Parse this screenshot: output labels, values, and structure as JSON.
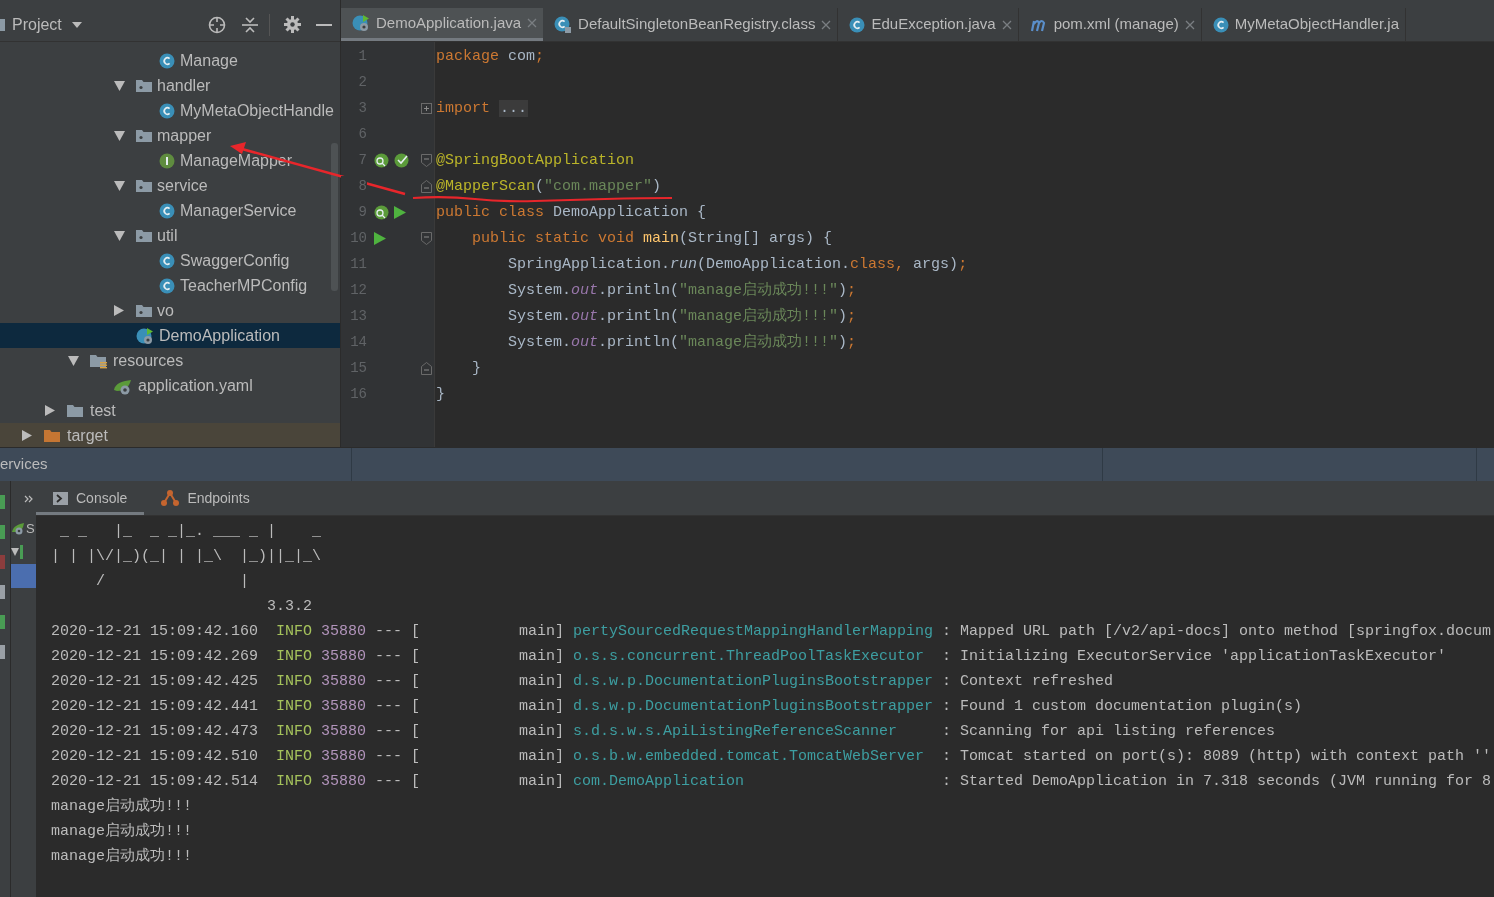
{
  "project_panel": {
    "title": "Project",
    "tree": [
      {
        "children": [
          {
            "children": [
              {
                "children": [
                  {
                    "children": [
                      {
                        "children": [
                          {
                            "label": "Manage",
                            "kind": "class",
                            "selected": false
                          }
                        ]
                      },
                      {
                        "label": "handler",
                        "kind": "package",
                        "expanded": true,
                        "selected": false,
                        "children": [
                          {
                            "label": "MyMetaObjectHandle",
                            "kind": "class",
                            "selected": false
                          }
                        ]
                      },
                      {
                        "label": "mapper",
                        "kind": "package",
                        "expanded": true,
                        "selected": false,
                        "children": [
                          {
                            "label": "ManageMapper",
                            "kind": "interface",
                            "selected": false
                          }
                        ]
                      },
                      {
                        "label": "service",
                        "kind": "package",
                        "expanded": true,
                        "selected": false,
                        "children": [
                          {
                            "label": "ManagerService",
                            "kind": "class",
                            "selected": false
                          }
                        ]
                      },
                      {
                        "label": "util",
                        "kind": "package",
                        "expanded": true,
                        "selected": false,
                        "children": [
                          {
                            "label": "SwaggerConfig",
                            "kind": "class",
                            "selected": false
                          },
                          {
                            "label": "TeacherMPConfig",
                            "kind": "class",
                            "selected": false
                          }
                        ]
                      },
                      {
                        "label": "vo",
                        "kind": "package",
                        "expanded": false,
                        "selected": false
                      },
                      {
                        "label": "DemoApplication",
                        "kind": "spring-class",
                        "selected": true
                      }
                    ]
                  }
                ]
              },
              {
                "label": "resources",
                "kind": "resources",
                "expanded": true,
                "selected": false,
                "children": [
                  {
                    "label": "application.yaml",
                    "kind": "yaml",
                    "selected": false
                  }
                ]
              }
            ]
          },
          {
            "label": "test",
            "kind": "folder",
            "expanded": false,
            "selected": false
          }
        ]
      },
      {
        "label": "target",
        "kind": "excluded",
        "expanded": false,
        "selected": false
      }
    ]
  },
  "tabs": [
    {
      "label": "DemoApplication.java",
      "kind": "spring",
      "selected": true,
      "closable": true
    },
    {
      "label": "DefaultSingletonBeanRegistry.class",
      "kind": "class-locked",
      "selected": false,
      "closable": true
    },
    {
      "label": "EduException.java",
      "kind": "class",
      "selected": false,
      "closable": true
    },
    {
      "label": "pom.xml (manage)",
      "kind": "maven",
      "selected": false,
      "closable": true
    },
    {
      "label": "MyMetaObjectHandler.ja",
      "kind": "class",
      "selected": false,
      "closable": false
    }
  ],
  "code": [
    {
      "number": "1",
      "tokens": [
        {
          "text": "package",
          "kind": "kw"
        },
        {
          "text": " com",
          "kind": "plain"
        },
        {
          "text": ";",
          "kind": "kw"
        }
      ]
    },
    {
      "number": "2"
    },
    {
      "number": "3",
      "folded": true,
      "tokens": [
        {
          "text": "import ",
          "kind": "kw"
        },
        {
          "text": "...",
          "kind": "folded"
        }
      ]
    },
    {
      "number": "6"
    },
    {
      "number": "7",
      "fold_start": true,
      "markers": [
        {
          "kind": "bean"
        },
        {
          "kind": "bean-check"
        }
      ],
      "tokens": [
        {
          "text": "@SpringBootApplication",
          "kind": "ann"
        }
      ]
    },
    {
      "number": "8",
      "fold_end": true,
      "tokens": [
        {
          "text": "@MapperScan",
          "kind": "ann"
        },
        {
          "text": "(",
          "kind": "plain"
        },
        {
          "text": "\"com.mapper\"",
          "kind": "str"
        },
        {
          "text": ")",
          "kind": "plain"
        }
      ]
    },
    {
      "number": "9",
      "markers": [
        {
          "kind": "bean"
        },
        {
          "kind": "run"
        }
      ],
      "tokens": [
        {
          "text": "public class ",
          "kind": "kw"
        },
        {
          "text": "DemoApplication {",
          "kind": "plain"
        }
      ]
    },
    {
      "number": "10",
      "fold_start": true,
      "markers": [
        {
          "kind": "run"
        }
      ],
      "tokens": [
        {
          "text": "    public static void ",
          "kind": "kw"
        },
        {
          "text": "main",
          "kind": "fn"
        },
        {
          "text": "(String[] args) {",
          "kind": "plain"
        }
      ]
    },
    {
      "number": "11",
      "tokens": [
        {
          "text": "        SpringApplication.",
          "kind": "plain"
        },
        {
          "text": "run",
          "kind": "static"
        },
        {
          "text": "(DemoApplication.",
          "kind": "plain"
        },
        {
          "text": "class, ",
          "kind": "kw"
        },
        {
          "text": "args)",
          "kind": "plain"
        },
        {
          "text": ";",
          "kind": "kw"
        }
      ]
    },
    {
      "number": "12",
      "tokens": [
        {
          "text": "        System.",
          "kind": "plain"
        },
        {
          "text": "out",
          "kind": "field"
        },
        {
          "text": ".println(",
          "kind": "plain"
        },
        {
          "text": "\"manage启动成功!!!\"",
          "kind": "str"
        },
        {
          "text": ")",
          "kind": "plain"
        },
        {
          "text": ";",
          "kind": "kw"
        }
      ]
    },
    {
      "number": "13",
      "tokens": [
        {
          "text": "        System.",
          "kind": "plain"
        },
        {
          "text": "out",
          "kind": "field"
        },
        {
          "text": ".println(",
          "kind": "plain"
        },
        {
          "text": "\"manage启动成功!!!\"",
          "kind": "str"
        },
        {
          "text": ")",
          "kind": "plain"
        },
        {
          "text": ";",
          "kind": "kw"
        }
      ]
    },
    {
      "number": "14",
      "tokens": [
        {
          "text": "        System.",
          "kind": "plain"
        },
        {
          "text": "out",
          "kind": "field"
        },
        {
          "text": ".println(",
          "kind": "plain"
        },
        {
          "text": "\"manage启动成功!!!\"",
          "kind": "str"
        },
        {
          "text": ")",
          "kind": "plain"
        },
        {
          "text": ";",
          "kind": "kw"
        }
      ]
    },
    {
      "number": "15",
      "fold_end": true,
      "tokens": [
        {
          "text": "    }",
          "kind": "plain"
        }
      ]
    },
    {
      "number": "16",
      "tokens": [
        {
          "text": "}",
          "kind": "plain"
        }
      ]
    }
  ],
  "services_bar": {
    "title": "ervices"
  },
  "services": [
    {
      "label": "S",
      "kind": "spring",
      "selected": false
    },
    {
      "kind": "group",
      "expanded": true,
      "selected": false
    },
    {
      "kind": "item",
      "selected": true
    }
  ],
  "console_tabs": [
    {
      "label": "Console",
      "kind": "console",
      "selected": true
    },
    {
      "label": "Endpoints",
      "kind": "endpoints",
      "selected": false
    }
  ],
  "console": [
    {
      "kind": "banner",
      "text": " _ _   |_  _ _|_. ___ _ |    _"
    },
    {
      "kind": "banner",
      "text": "| | |\\/|_)(_| | |_\\  |_)||_|_\\"
    },
    {
      "kind": "banner",
      "text": "     /               |"
    },
    {
      "kind": "banner",
      "text": "                        3.3.2"
    },
    {
      "kind": "log",
      "timestamp": "2020-12-21 15:09:42.160",
      "level": "INFO",
      "pid": "35880",
      "separator": "---",
      "thread": "[           main]",
      "logger": "pertySourcedRequestMappingHandlerMapping",
      "message": ": Mapped URL path [/v2/api-docs] onto method [springfox.docum"
    },
    {
      "kind": "log",
      "timestamp": "2020-12-21 15:09:42.269",
      "level": "INFO",
      "pid": "35880",
      "separator": "---",
      "thread": "[           main]",
      "logger": "o.s.s.concurrent.ThreadPoolTaskExecutor",
      "message": ": Initializing ExecutorService 'applicationTaskExecutor'"
    },
    {
      "kind": "log",
      "timestamp": "2020-12-21 15:09:42.425",
      "level": "INFO",
      "pid": "35880",
      "separator": "---",
      "thread": "[           main]",
      "logger": "d.s.w.p.DocumentationPluginsBootstrapper",
      "message": ": Context refreshed"
    },
    {
      "kind": "log",
      "timestamp": "2020-12-21 15:09:42.441",
      "level": "INFO",
      "pid": "35880",
      "separator": "---",
      "thread": "[           main]",
      "logger": "d.s.w.p.DocumentationPluginsBootstrapper",
      "message": ": Found 1 custom documentation plugin(s)"
    },
    {
      "kind": "log",
      "timestamp": "2020-12-21 15:09:42.473",
      "level": "INFO",
      "pid": "35880",
      "separator": "---",
      "thread": "[           main]",
      "logger": "s.d.s.w.s.ApiListingReferenceScanner",
      "message": ": Scanning for api listing references"
    },
    {
      "kind": "log",
      "timestamp": "2020-12-21 15:09:42.510",
      "level": "INFO",
      "pid": "35880",
      "separator": "---",
      "thread": "[           main]",
      "logger": "o.s.b.w.embedded.tomcat.TomcatWebServer",
      "message": ": Tomcat started on port(s): 8089 (http) with context path ''"
    },
    {
      "kind": "log",
      "timestamp": "2020-12-21 15:09:42.514",
      "level": "INFO",
      "pid": "35880",
      "separator": "---",
      "thread": "[           main]",
      "logger": "com.DemoApplication",
      "message": ": Started DemoApplication in 7.318 seconds (JVM running for 8"
    },
    {
      "kind": "output",
      "text": "manage启动成功!!!"
    },
    {
      "kind": "output",
      "text": "manage启动成功!!!"
    },
    {
      "kind": "output",
      "text": "manage启动成功!!!"
    }
  ]
}
